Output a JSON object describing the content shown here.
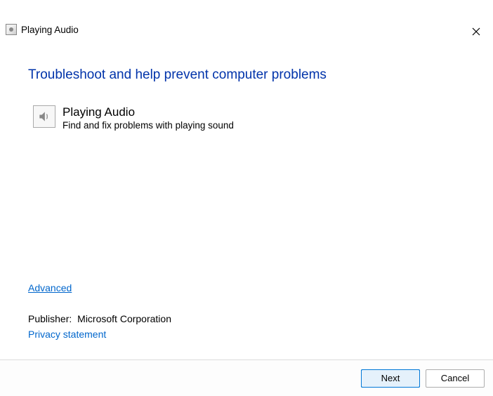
{
  "window": {
    "title": "Playing Audio"
  },
  "heading": "Troubleshoot and help prevent computer problems",
  "troubleshooter": {
    "title": "Playing Audio",
    "description": "Find and fix problems with playing sound"
  },
  "links": {
    "advanced": "Advanced",
    "privacy": "Privacy statement"
  },
  "publisher": {
    "label": "Publisher:",
    "value": "Microsoft Corporation"
  },
  "buttons": {
    "next": "Next",
    "cancel": "Cancel"
  }
}
